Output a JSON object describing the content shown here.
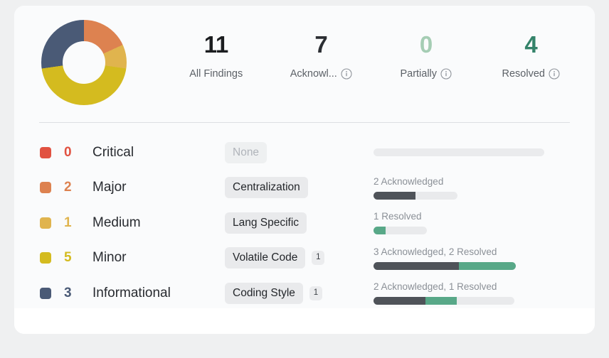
{
  "summary": {
    "stats": [
      {
        "value": "11",
        "label": "All Findings",
        "color": "#1b1d20",
        "info": false,
        "icon": ""
      },
      {
        "value": "7",
        "label": "Acknowl...",
        "color": "#2b2e33",
        "info": true,
        "icon": "info-circle-icon"
      },
      {
        "value": "0",
        "label": "Partially",
        "color": "#a5cdb4",
        "info": true,
        "icon": "info-circle-icon"
      },
      {
        "value": "4",
        "label": "Resolved",
        "color": "#34836a",
        "info": true,
        "icon": "info-circle-icon"
      }
    ]
  },
  "chart_data": {
    "type": "pie",
    "title": "Findings by severity",
    "categories": [
      "Major",
      "Medium",
      "Minor",
      "Informational"
    ],
    "values": [
      2,
      1,
      5,
      3
    ],
    "colors": [
      "#dd8250",
      "#e0b44e",
      "#d4bb1f",
      "#4a5a76"
    ],
    "total": 11,
    "legend": "inline-rows",
    "donut": true,
    "inner_radius_ratio": 0.5
  },
  "rows": [
    {
      "severity": "Critical",
      "count": "0",
      "color": "#e15241",
      "tag": "None",
      "tag_muted": true,
      "tag_badge": "",
      "bar_caption": "",
      "bar_total": 0,
      "acknowledged": 0,
      "resolved": 0,
      "track_width": 240,
      "ack_pct": 0,
      "res_pct": 0
    },
    {
      "severity": "Major",
      "count": "2",
      "color": "#dd8250",
      "tag": "Centralization",
      "tag_muted": false,
      "tag_badge": "",
      "bar_caption": "2 Acknowledged",
      "bar_total": 2,
      "acknowledged": 2,
      "resolved": 0,
      "track_width": 118,
      "ack_pct": 50,
      "res_pct": 0
    },
    {
      "severity": "Medium",
      "count": "1",
      "color": "#e0b44e",
      "tag": "Lang Specific",
      "tag_muted": false,
      "tag_badge": "",
      "bar_caption": "1 Resolved",
      "bar_total": 1,
      "acknowledged": 0,
      "resolved": 1,
      "track_width": 75,
      "ack_pct": 0,
      "res_pct": 22
    },
    {
      "severity": "Minor",
      "count": "5",
      "color": "#d4bb1f",
      "tag": "Volatile Code",
      "tag_muted": false,
      "tag_badge": "1",
      "bar_caption": "3 Acknowledged, 2 Resolved",
      "bar_total": 5,
      "acknowledged": 3,
      "resolved": 2,
      "track_width": 200,
      "ack_pct": 60,
      "res_pct": 40
    },
    {
      "severity": "Informational",
      "count": "3",
      "color": "#4a5a76",
      "tag": "Coding Style",
      "tag_muted": false,
      "tag_badge": "1",
      "bar_caption": "2 Acknowledged, 1 Resolved",
      "bar_total": 3,
      "acknowledged": 2,
      "resolved": 1,
      "track_width": 198,
      "ack_pct": 37,
      "res_pct": 22
    }
  ],
  "theme": {
    "card_bg": "#fafbfc",
    "page_bg": "#eff0f1",
    "ack_color": "#4f5359",
    "resolved_color": "#58a888",
    "track_color": "#e9eaec"
  }
}
